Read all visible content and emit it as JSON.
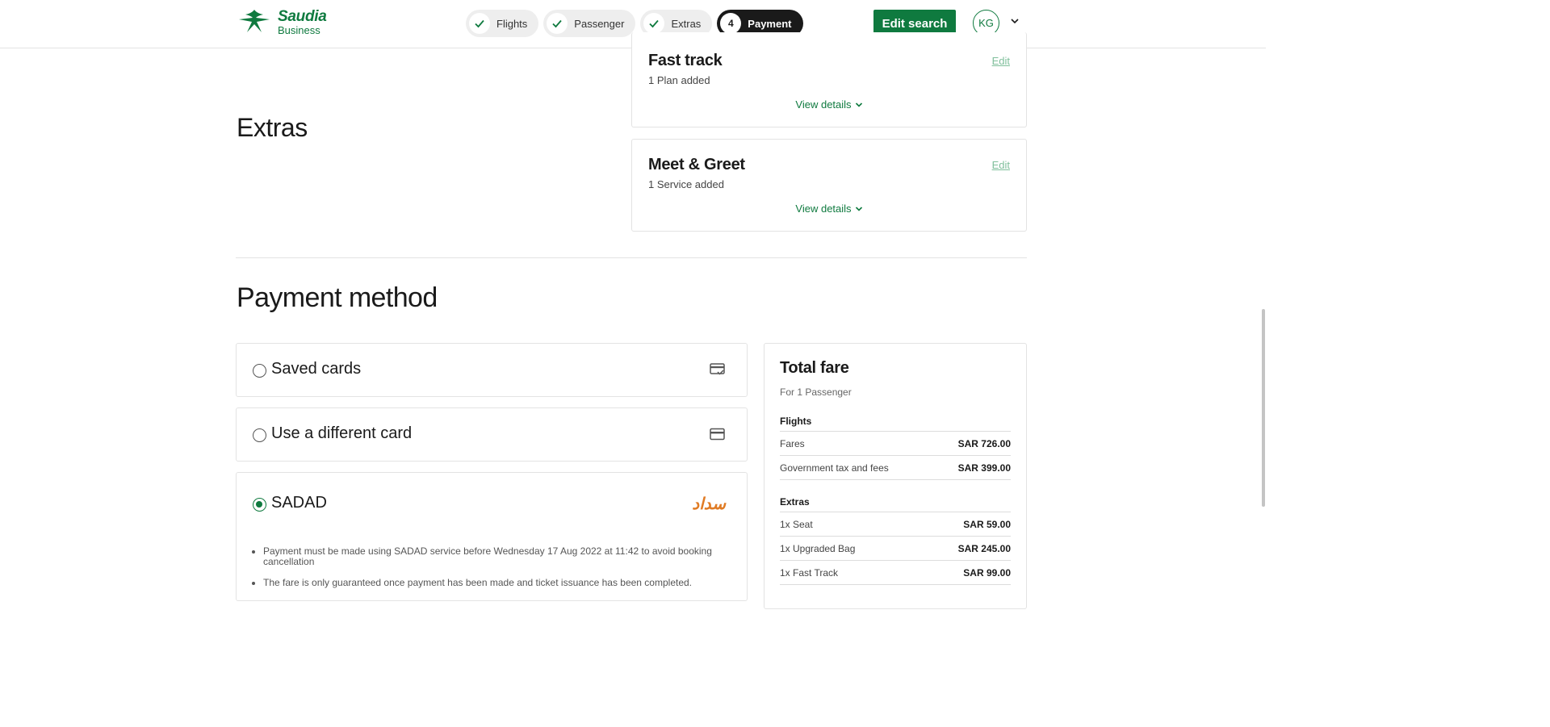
{
  "header": {
    "logo_name": "Saudia",
    "logo_sub": "Business",
    "steps": [
      {
        "label": "Flights",
        "state": "done"
      },
      {
        "label": "Passenger",
        "state": "done"
      },
      {
        "label": "Extras",
        "state": "done"
      },
      {
        "label": "Payment",
        "state": "active",
        "number": "4"
      }
    ],
    "edit_search_label": "Edit search",
    "avatar_initials": "KG"
  },
  "extras": {
    "title": "Extras",
    "cards": [
      {
        "title": "Fast track",
        "subtitle": "1 Plan added",
        "edit_label": "Edit",
        "view_label": "View details"
      },
      {
        "title": "Meet & Greet",
        "subtitle": "1 Service added",
        "edit_label": "Edit",
        "view_label": "View details"
      }
    ]
  },
  "payment": {
    "title": "Payment method",
    "options": [
      {
        "label": "Saved cards",
        "icon": "saved-card-icon",
        "selected": false
      },
      {
        "label": "Use a different card",
        "icon": "credit-card-icon",
        "selected": false
      },
      {
        "label": "SADAD",
        "icon": "sadad-logo",
        "selected": true,
        "logo_text": "سداد"
      }
    ],
    "notes": [
      "Payment must be made using SADAD service before Wednesday 17 Aug 2022 at 11:42 to avoid booking cancellation",
      "The fare is only guaranteed once payment has been made and ticket issuance has been completed."
    ]
  },
  "fare": {
    "title": "Total fare",
    "passengers": "For 1 Passenger",
    "sections": [
      {
        "title": "Flights",
        "rows": [
          {
            "label": "Fares",
            "value": "SAR 726.00"
          },
          {
            "label": "Government tax and fees",
            "value": "SAR 399.00"
          }
        ]
      },
      {
        "title": "Extras",
        "rows": [
          {
            "label": "1x Seat",
            "value": "SAR 59.00"
          },
          {
            "label": "1x Upgraded Bag",
            "value": "SAR 245.00"
          },
          {
            "label": "1x Fast Track",
            "value": "SAR 99.00"
          }
        ]
      }
    ]
  },
  "colors": {
    "brand_green": "#0f7a3f",
    "sadad_orange": "#e07b24",
    "active_step": "#1a1a1a"
  }
}
